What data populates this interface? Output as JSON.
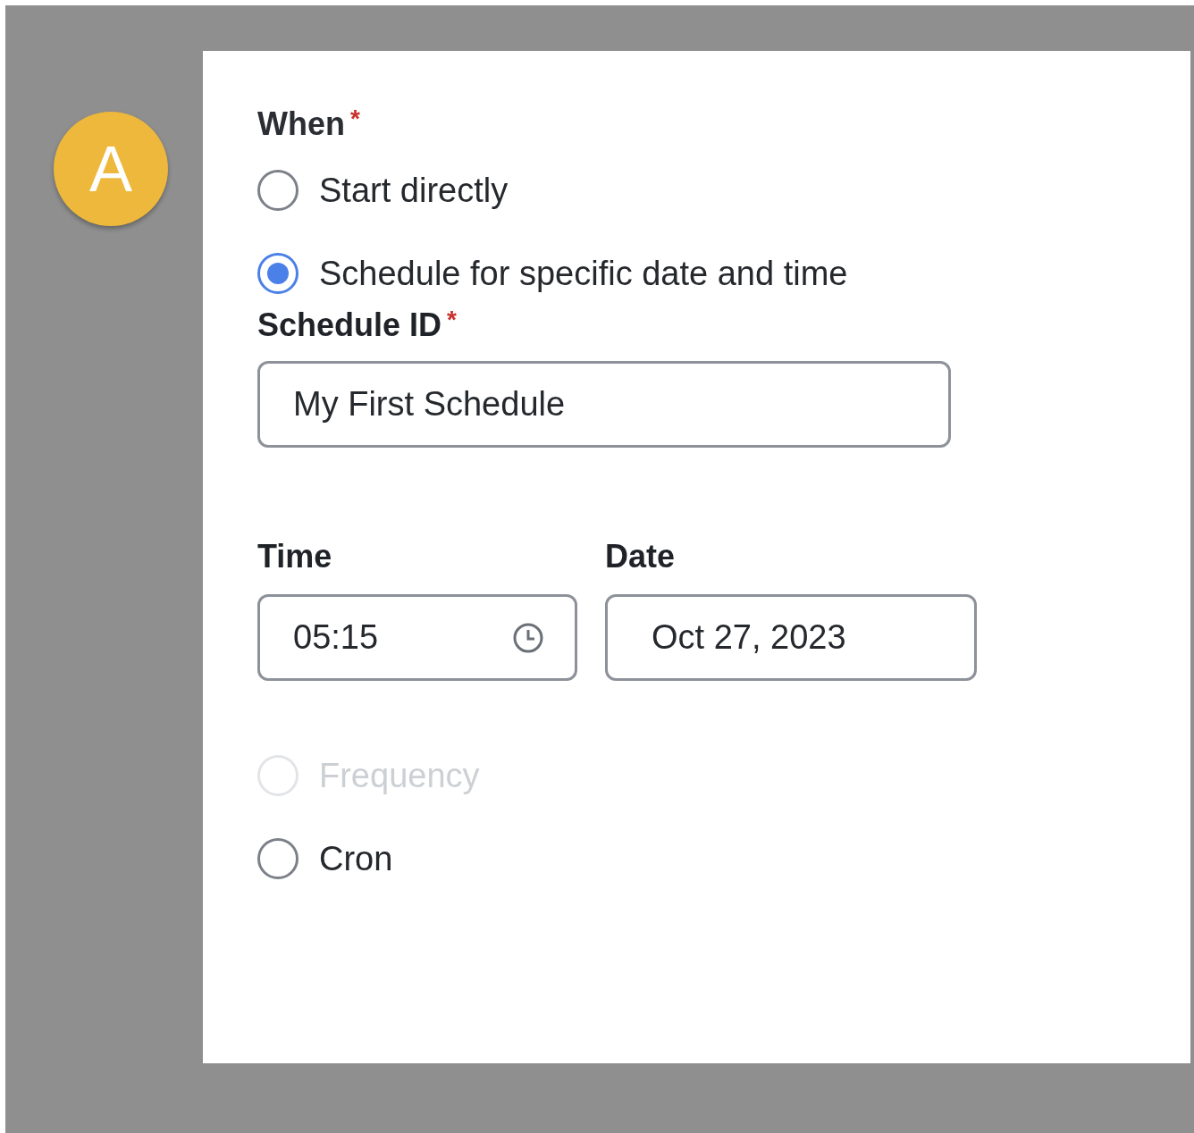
{
  "step_badge": "A",
  "when": {
    "label": "When",
    "required_mark": "*",
    "options": [
      {
        "label": "Start directly",
        "selected": false,
        "disabled": false
      },
      {
        "label": "Schedule for specific date and time",
        "selected": true,
        "disabled": false
      }
    ]
  },
  "schedule_id": {
    "label": "Schedule ID",
    "required_mark": "*",
    "value": "My First Schedule"
  },
  "time": {
    "label": "Time",
    "value": "05:15"
  },
  "date": {
    "label": "Date",
    "value": "Oct 27, 2023"
  },
  "repeat_options": [
    {
      "label": "Frequency",
      "selected": false,
      "disabled": true
    },
    {
      "label": "Cron",
      "selected": false,
      "disabled": false
    }
  ]
}
